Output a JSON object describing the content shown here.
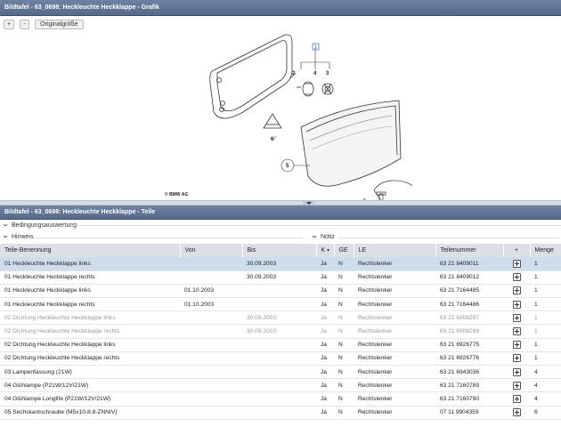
{
  "header": {
    "title": "Bildtafel - 63_0698: Heckleuchte Heckklappe - Grafik"
  },
  "toolbar": {
    "zoom_in": "+",
    "zoom_out": "-",
    "original_size": "Originalgröße"
  },
  "drawing": {
    "callouts": [
      "1",
      "2",
      "3",
      "4",
      "5",
      "6",
      "5"
    ],
    "copyright": "© BMW AG",
    "image_id": "00086443"
  },
  "parts_header": {
    "title": "Bildtafel - 63_0698: Heckleuchte Heckklappe - Teile"
  },
  "sections": {
    "conditions": "Bedingungsauswertung",
    "hint": "Hinweis",
    "note": "Notiz"
  },
  "table": {
    "columns": [
      "Teile-Benennung",
      "Von",
      "Bis",
      "K",
      "GE",
      "LE",
      "Teilenummer",
      "+",
      "Menge"
    ],
    "rows": [
      {
        "name": "01 Heckleuchte Heckklappe links",
        "von": "",
        "bis": "30.09.2003",
        "k": "Ja",
        "ge": "N",
        "le": "Rechtslenker",
        "nr": "63 21 8409011",
        "menge": "1",
        "style": "sel"
      },
      {
        "name": "01 Heckleuchte Heckklappe rechts",
        "von": "",
        "bis": "30.09.2003",
        "k": "Ja",
        "ge": "N",
        "le": "Rechtslenker",
        "nr": "63 21 8409012",
        "menge": "1",
        "style": ""
      },
      {
        "name": "01 Heckleuchte Heckklappe links",
        "von": "01.10.2003",
        "bis": "",
        "k": "Ja",
        "ge": "N",
        "le": "Rechtslenker",
        "nr": "63 21 7164485",
        "menge": "1",
        "style": ""
      },
      {
        "name": "01 Heckleuchte Heckklappe rechts",
        "von": "01.10.2003",
        "bis": "",
        "k": "Ja",
        "ge": "N",
        "le": "Rechtslenker",
        "nr": "63 21 7164486",
        "menge": "1",
        "style": ""
      },
      {
        "name": "02 Dichtung Heckleuchte Heckklappe links",
        "von": "",
        "bis": "30.09.2003",
        "k": "Ja",
        "ge": "N",
        "le": "Rechtslenker",
        "nr": "63 21 6908287",
        "menge": "1",
        "style": "grey"
      },
      {
        "name": "02 Dichtung Heckleuchte Heckklappe rechts",
        "von": "",
        "bis": "30.09.2003",
        "k": "Ja",
        "ge": "N",
        "le": "Rechtslenker",
        "nr": "63 21 6908288",
        "menge": "1",
        "style": "grey"
      },
      {
        "name": "02 Dichtung Heckleuchte Heckklappe links",
        "von": "",
        "bis": "",
        "k": "Ja",
        "ge": "N",
        "le": "Rechtslenker",
        "nr": "63 21 6926775",
        "menge": "1",
        "style": ""
      },
      {
        "name": "02 Dichtung Heckleuchte Heckklappe rechts",
        "von": "",
        "bis": "",
        "k": "Ja",
        "ge": "N",
        "le": "Rechtslenker",
        "nr": "63 21 6926776",
        "menge": "1",
        "style": ""
      },
      {
        "name": "03 Lampenfassung (21W)",
        "von": "",
        "bis": "",
        "k": "Ja",
        "ge": "N",
        "le": "Rechtslenker",
        "nr": "63 21 6943036",
        "menge": "4",
        "style": ""
      },
      {
        "name": "04 Glühlampe (P21W/12V/21W)",
        "von": "",
        "bis": "",
        "k": "Ja",
        "ge": "N",
        "le": "Rechtslenker",
        "nr": "63 21 7160789",
        "menge": "4",
        "style": ""
      },
      {
        "name": "04 Glühlampe Longlife (P21W/12V/21W)",
        "von": "",
        "bis": "",
        "k": "Ja",
        "ge": "N",
        "le": "Rechtslenker",
        "nr": "63 21 7160790",
        "menge": "4",
        "style": ""
      },
      {
        "name": "05 Sechskantschraube (M5x10-8.8-ZNNIV)",
        "von": "",
        "bis": "",
        "k": "Ja",
        "ge": "N",
        "le": "Rechtslenker",
        "nr": "07 11 9904359",
        "menge": "6",
        "style": ""
      }
    ]
  },
  "colors": {
    "titlebar": "#56698a",
    "selected_row": "#cfdcec",
    "header_row": "#dcdfe4"
  }
}
